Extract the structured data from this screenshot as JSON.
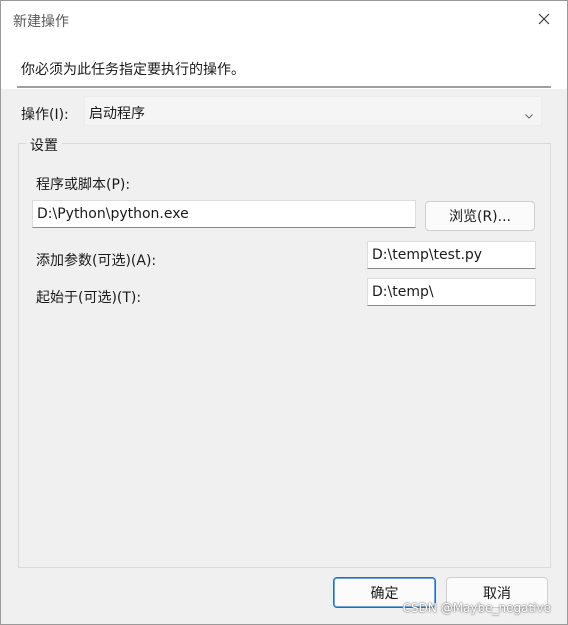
{
  "window": {
    "title": "新建操作",
    "close_icon": "close-icon"
  },
  "header": {
    "instruction": "你必须为此任务指定要执行的操作。"
  },
  "action": {
    "label": "操作(I):",
    "selected": "启动程序",
    "dropdown_icon": "chevron-down-icon"
  },
  "settings": {
    "caption": "设置",
    "program_label": "程序或脚本(P):",
    "program_value": "D:\\Python\\python.exe",
    "browse_label": "浏览(R)...",
    "args_label": "添加参数(可选)(A):",
    "args_value": "D:\\temp\\test.py",
    "startin_label": "起始于(可选)(T):",
    "startin_value": "D:\\temp\\"
  },
  "footer": {
    "ok_label": "确定",
    "cancel_label": "取消"
  },
  "watermark": "CSDN @Maybe_negative",
  "colors": {
    "window_bg": "#f0f0f0",
    "primary_border": "#1a6fc9"
  }
}
